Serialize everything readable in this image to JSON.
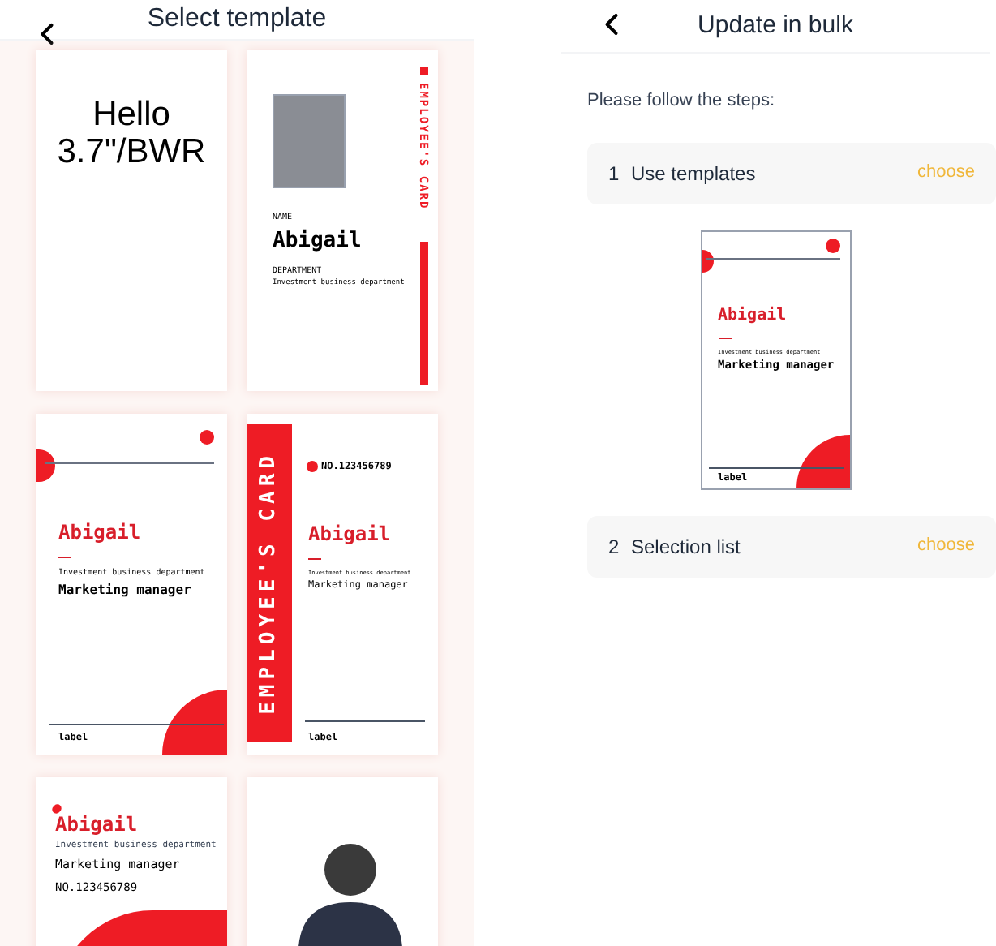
{
  "left": {
    "title": "Select template",
    "templates": [
      {
        "kind": "text",
        "lines": [
          "Hello",
          "3.7\"/BWR"
        ]
      },
      {
        "kind": "photo",
        "side_text": "EMPLOYEE'S CARD",
        "name_label": "NAME",
        "name": "Abigail",
        "dept_label": "DEPARTMENT",
        "dept": "Investment business department"
      },
      {
        "kind": "circle",
        "name": "Abigail",
        "dept": "Investment business department",
        "role": "Marketing manager",
        "footer": "label"
      },
      {
        "kind": "banner",
        "banner": "EMPLOYEE'S CARD",
        "number": "NO.123456789",
        "name": "Abigail",
        "dept": "Investment business department",
        "role": "Marketing manager",
        "footer": "label"
      },
      {
        "kind": "wave",
        "name": "Abigail",
        "dept": "Investment business department",
        "role": "Marketing manager",
        "number": "NO.123456789"
      },
      {
        "kind": "portrait"
      }
    ]
  },
  "right": {
    "title": "Update in bulk",
    "instruction": "Please follow the steps:",
    "steps": [
      {
        "number": "1",
        "label": "Use templates",
        "action": "choose",
        "preview": {
          "name": "Abigail",
          "dept": "Investment business department",
          "role": "Marketing manager",
          "footer": "label"
        }
      },
      {
        "number": "2",
        "label": "Selection list",
        "action": "choose"
      }
    ]
  }
}
